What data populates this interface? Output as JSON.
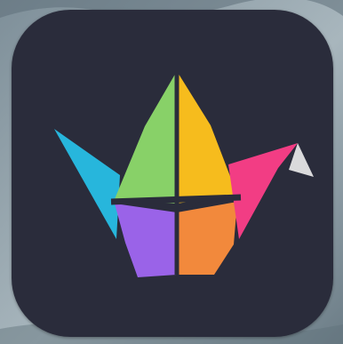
{
  "app_icon": {
    "icon_name": "origami-crane-icon",
    "tile_color": "#2a2c3b",
    "colors": {
      "left_wing": "#27b6dc",
      "body_left": "#88d168",
      "body_right": "#f6bc1d",
      "base_left": "#9a63e8",
      "base_right": "#f2893c",
      "right_wing": "#f23d84",
      "beak": "#dadadc",
      "creases": "#2a2c3b"
    }
  },
  "wallpaper": {
    "colors": [
      "#7e8f99",
      "#a8b6bd",
      "#6b7c86"
    ]
  }
}
